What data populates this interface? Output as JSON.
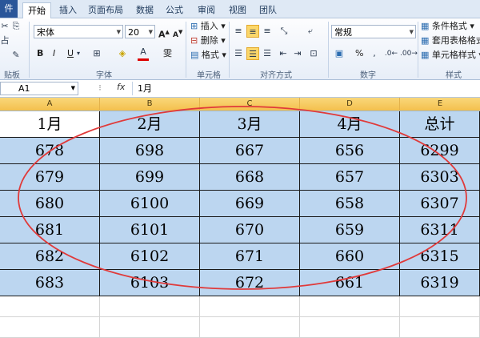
{
  "ribbon_tabs": [
    "件",
    "开始",
    "插入",
    "页面布局",
    "数据",
    "公式",
    "审阅",
    "视图",
    "团队"
  ],
  "clipboard": {
    "group_label": "贴板",
    "paste_label": "占"
  },
  "font": {
    "name": "宋体",
    "size": "20",
    "grow": "A",
    "shrink": "A",
    "bold": "B",
    "italic": "I",
    "underline": "U",
    "group_label": "字体",
    "phonetic": "雯"
  },
  "cells_group": {
    "insert": "插入",
    "delete": "删除",
    "format": "格式",
    "group_label": "单元格"
  },
  "alignment": {
    "group_label": "对齐方式"
  },
  "number": {
    "format": "常规",
    "percent": "%",
    "group_label": "数字"
  },
  "styles": {
    "conditional": "条件格式",
    "table": "套用表格格式",
    "cell_styles": "单元格样式",
    "group_label": "样式"
  },
  "formula_bar": {
    "cell_ref": "A1",
    "fx": "fx",
    "content": "1月"
  },
  "columns": [
    "A",
    "B",
    "C",
    "D",
    "E"
  ],
  "table": {
    "headers": [
      "1月",
      "2月",
      "3月",
      "4月",
      "总计"
    ],
    "rows": [
      [
        "678",
        "698",
        "667",
        "656",
        "6299"
      ],
      [
        "679",
        "699",
        "668",
        "657",
        "6303"
      ],
      [
        "680",
        "6100",
        "669",
        "658",
        "6307"
      ],
      [
        "681",
        "6101",
        "670",
        "659",
        "6311"
      ],
      [
        "682",
        "6102",
        "671",
        "660",
        "6315"
      ],
      [
        "683",
        "6103",
        "672",
        "661",
        "6319"
      ]
    ]
  },
  "annotation_color": "#e03a3a",
  "selection_color": "#bcd6f0"
}
